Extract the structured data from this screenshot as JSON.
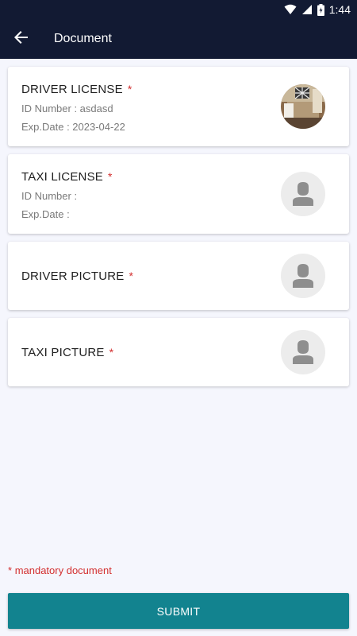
{
  "status_bar": {
    "time": "1:44"
  },
  "app_bar": {
    "title": "Document",
    "back_icon": "arrow-left-icon"
  },
  "documents": [
    {
      "title": "DRIVER LICENSE",
      "required_mark": "*",
      "id_line": "ID Number : asdasd",
      "exp_line": "Exp.Date : 2023-04-22",
      "thumbnail": "photo"
    },
    {
      "title": "TAXI LICENSE",
      "required_mark": "*",
      "id_line": "ID Number :",
      "exp_line": "Exp.Date :",
      "thumbnail": "person-placeholder-icon"
    },
    {
      "title": "DRIVER PICTURE",
      "required_mark": "*",
      "thumbnail": "person-placeholder-icon"
    },
    {
      "title": "TAXI PICTURE",
      "required_mark": "*",
      "thumbnail": "person-placeholder-icon"
    }
  ],
  "footer": {
    "mandatory_mark": "*",
    "mandatory_text": "mandatory document",
    "submit_label": "SUBMIT"
  },
  "colors": {
    "app_bar": "#121a33",
    "background": "#f5f6fd",
    "required": "#d32f2f",
    "submit": "#12838f"
  }
}
